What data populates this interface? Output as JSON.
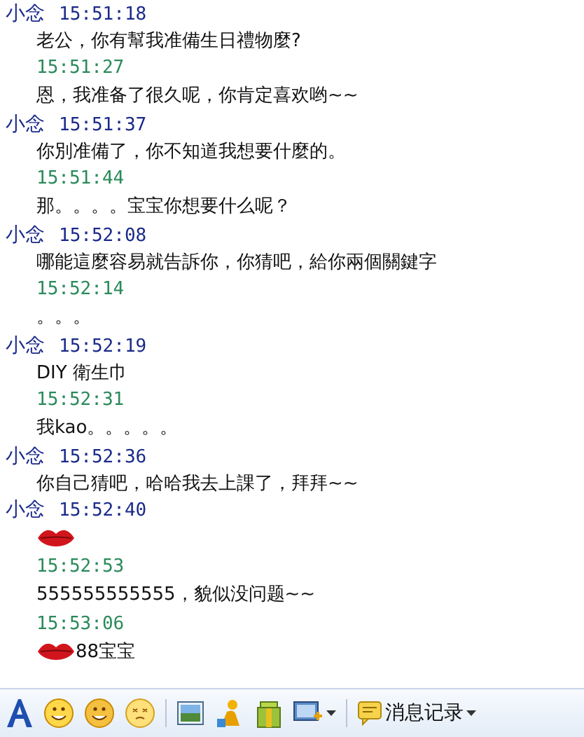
{
  "messages": [
    {
      "kind": "incoming",
      "sender": "小念",
      "time": "15:51:18",
      "text": "老公，你有幫我准備生日禮物麼?"
    },
    {
      "kind": "outgoing",
      "time": "15:51:27",
      "text": "恩，我准备了很久呢，你肯定喜欢哟~~"
    },
    {
      "kind": "incoming",
      "sender": "小念",
      "time": "15:51:37",
      "text": "你別准備了，你不知道我想要什麼的。"
    },
    {
      "kind": "outgoing",
      "time": "15:51:44",
      "text": "那。。。。宝宝你想要什么呢？"
    },
    {
      "kind": "incoming",
      "sender": "小念",
      "time": "15:52:08",
      "text": "哪能這麼容易就告訴你，你猜吧，給你兩個關鍵字"
    },
    {
      "kind": "outgoing",
      "time": "15:52:14",
      "text": "。。。"
    },
    {
      "kind": "incoming",
      "sender": "小念",
      "time": "15:52:19",
      "text": "DIY 衛生巾"
    },
    {
      "kind": "outgoing",
      "time": "15:52:31",
      "text": "我kao。。。。。"
    },
    {
      "kind": "incoming",
      "sender": "小念",
      "time": "15:52:36",
      "text": "你自己猜吧，哈哈我去上課了，拜拜~~"
    },
    {
      "kind": "incoming",
      "sender": "小念",
      "time": "15:52:40",
      "kiss": true
    },
    {
      "kind": "outgoing",
      "time": "15:52:53",
      "text": "555555555555，貌似没问题~~"
    },
    {
      "kind": "outgoing",
      "time": "15:53:06",
      "kiss": true,
      "text": "88宝宝"
    }
  ],
  "toolbar": {
    "history_label": "消息记录"
  }
}
